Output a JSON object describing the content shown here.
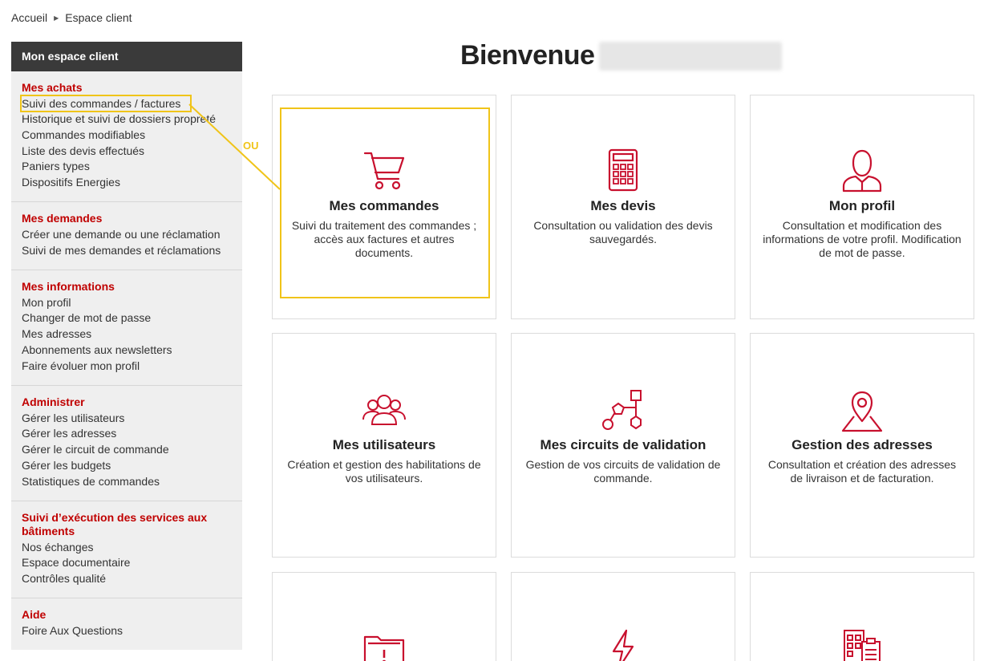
{
  "breadcrumb": {
    "home": "Accueil",
    "current": "Espace client"
  },
  "sidebar": {
    "header": "Mon espace client",
    "sections": [
      {
        "title": "Mes achats",
        "links": [
          "Suivi des commandes / factures",
          "Historique et suivi de dossiers propreté",
          "Commandes modifiables",
          "Liste des devis effectués",
          "Paniers types",
          "Dispositifs Energies"
        ]
      },
      {
        "title": "Mes demandes",
        "links": [
          "Créer une demande ou une réclamation",
          "Suivi de mes demandes et réclamations"
        ]
      },
      {
        "title": "Mes informations",
        "links": [
          "Mon profil",
          "Changer de mot de passe",
          "Mes adresses",
          "Abonnements aux newsletters",
          "Faire évoluer mon profil"
        ]
      },
      {
        "title": "Administrer",
        "links": [
          "Gérer les utilisateurs",
          "Gérer les adresses",
          "Gérer le circuit de commande",
          "Gérer les budgets",
          "Statistiques de commandes"
        ]
      },
      {
        "title": "Suivi d’exécution des services aux bâtiments",
        "links": [
          "Nos échanges",
          "Espace documentaire",
          "Contrôles qualité"
        ]
      },
      {
        "title": "Aide",
        "links": [
          "Foire Aux Questions"
        ]
      }
    ]
  },
  "welcome": "Bienvenue",
  "annotation": {
    "ou": "OU",
    "highlight_color": "#f0c419"
  },
  "accent_color": "#c8102e",
  "tiles": [
    {
      "icon": "cart-icon",
      "title": "Mes commandes",
      "desc": "Suivi du traitement des commandes ; accès aux factures et autres documents."
    },
    {
      "icon": "calculator-icon",
      "title": "Mes devis",
      "desc": "Consultation ou validation des devis sauvegardés."
    },
    {
      "icon": "user-icon",
      "title": "Mon profil",
      "desc": "Consultation et modification des informations de votre profil. Modification de mot de passe."
    },
    {
      "icon": "users-group-icon",
      "title": "Mes utilisateurs",
      "desc": "Création et gestion des habilitations de vos utilisateurs."
    },
    {
      "icon": "workflow-icon",
      "title": "Mes circuits de validation",
      "desc": "Gestion de vos circuits de validation de commande."
    },
    {
      "icon": "map-pin-icon",
      "title": "Gestion des adresses",
      "desc": "Consultation et création des adresses de livraison et de facturation."
    },
    {
      "icon": "folder-alert-icon",
      "title": "",
      "desc": ""
    },
    {
      "icon": "lightning-icon",
      "title": "",
      "desc": ""
    },
    {
      "icon": "building-clipboard-icon",
      "title": "",
      "desc": ""
    }
  ]
}
